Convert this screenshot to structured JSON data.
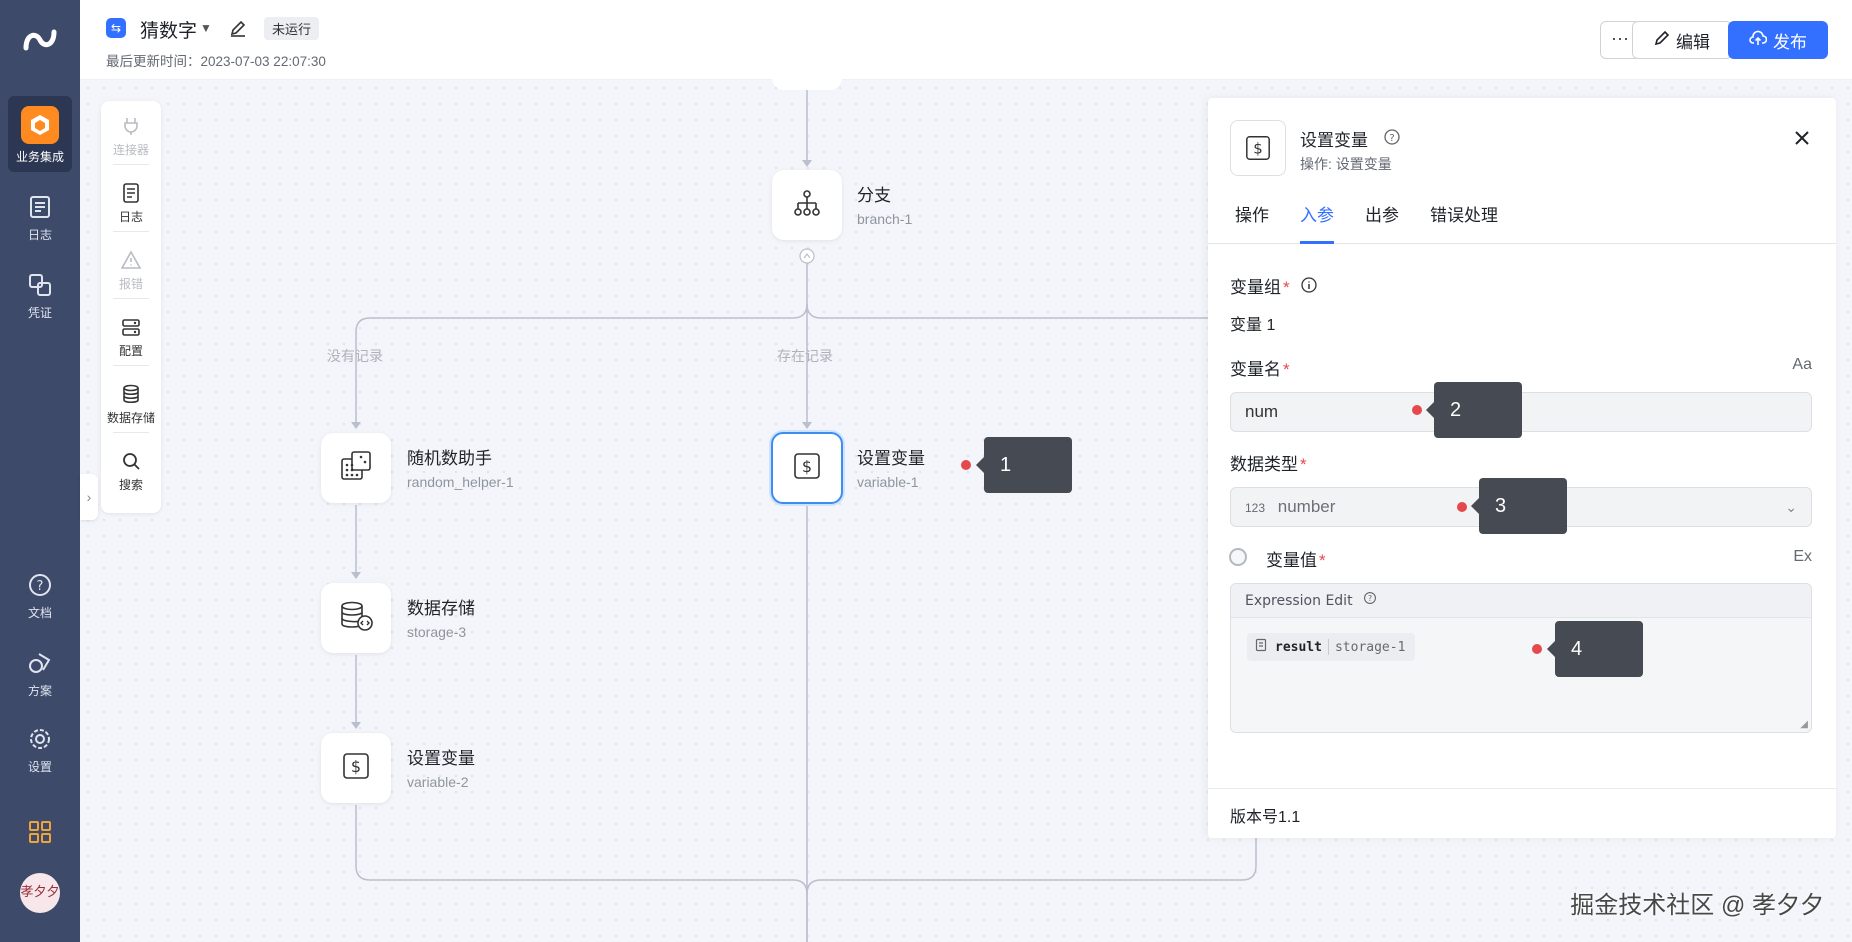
{
  "nav": {
    "items": [
      {
        "label": "业务集成",
        "icon": "integration-icon"
      },
      {
        "label": "日志",
        "icon": "log-icon"
      },
      {
        "label": "凭证",
        "icon": "credential-icon"
      },
      {
        "label": "文档",
        "icon": "help-icon"
      },
      {
        "label": "方案",
        "icon": "solution-icon"
      },
      {
        "label": "设置",
        "icon": "gear-icon"
      }
    ],
    "avatar_text": "孝夕夕"
  },
  "header": {
    "title": "猜数字",
    "status": "未运行",
    "updated": "最后更新时间：2023-07-03 22:07:30",
    "more": "···",
    "edit_label": "编辑",
    "publish_label": "发布"
  },
  "toolbar": {
    "items": [
      {
        "label": "连接器",
        "disabled": true
      },
      {
        "label": "日志",
        "disabled": false
      },
      {
        "label": "报错",
        "disabled": true
      },
      {
        "label": "配置",
        "disabled": false
      },
      {
        "label": "数据存储",
        "disabled": false
      },
      {
        "label": "搜索",
        "disabled": false
      }
    ]
  },
  "flow": {
    "branch": {
      "title": "分支",
      "id": "branch-1"
    },
    "branch_labels": {
      "left": "没有记录",
      "middle": "存在记录"
    },
    "nodes": [
      {
        "title": "随机数助手",
        "id": "random_helper-1"
      },
      {
        "title": "数据存储",
        "id": "storage-3"
      },
      {
        "title": "设置变量",
        "id": "variable-2"
      },
      {
        "title": "设置变量",
        "id": "variable-1"
      }
    ]
  },
  "callouts": [
    "1",
    "2",
    "3",
    "4"
  ],
  "panel": {
    "title": "设置变量",
    "subtitle": "操作: 设置变量",
    "tabs": [
      "操作",
      "入参",
      "出参",
      "错误处理"
    ],
    "active_tab": "入参",
    "group_label": "变量组",
    "group_name": "变量 1",
    "var_name_label": "变量名",
    "var_name_value": "num",
    "var_name_toggle": "Aa",
    "type_label": "数据类型",
    "type_prefix": "123",
    "type_value": "number",
    "value_label": "变量值",
    "value_toggle": "Ex",
    "expr_header": "Expression Edit",
    "expr_key": "result",
    "expr_source": "storage-1",
    "version": "版本号1.1"
  },
  "watermark": "掘金技术社区 @ 孝夕夕",
  "colors": {
    "accent": "#3370ff",
    "nav_bg": "#3d4a6a",
    "brand_orange": "#ff8a1f",
    "callout_dot": "#e5484d"
  }
}
